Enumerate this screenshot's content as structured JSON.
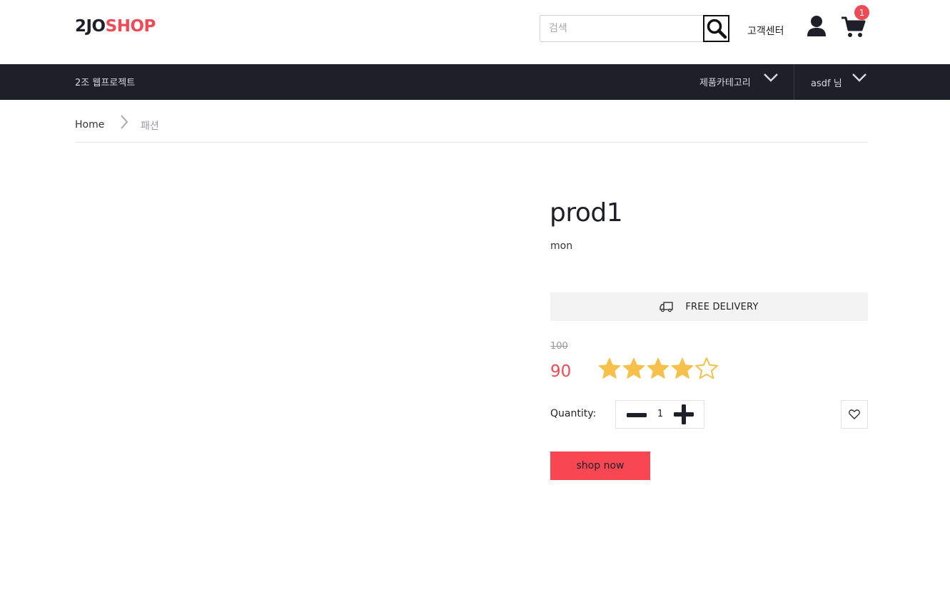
{
  "header": {
    "logo_part1": "2JO",
    "logo_part2": "SHOP",
    "search_placeholder": "검색",
    "customer_center": "고객센터",
    "cart_count": "1"
  },
  "navbar": {
    "brand": "2조 웹프로젝트",
    "category_menu": "제품카테고리",
    "user_menu": "asdf 님"
  },
  "breadcrumb": {
    "home": "Home",
    "current": "패션"
  },
  "product": {
    "name": "prod1",
    "subtitle": "mon",
    "delivery_label": "FREE DELIVERY",
    "old_price": "100",
    "price": "90",
    "rating": 4,
    "rating_max": 5,
    "quantity_label": "Quantity:",
    "quantity": "1",
    "shop_button": "shop now"
  },
  "colors": {
    "accent": "#f04b55",
    "dark": "#1f1f2a",
    "star": "#f7c04a"
  }
}
